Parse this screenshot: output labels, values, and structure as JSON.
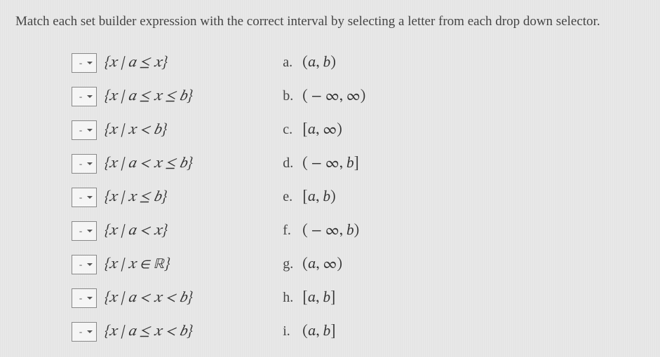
{
  "instructions": "Match each set builder expression with the correct interval by selecting a letter from each drop down selector.",
  "selector_placeholder": "-",
  "questions": [
    {
      "expr": "{𝑥 | 𝑎 ≤ 𝑥}"
    },
    {
      "expr": "{𝑥 | 𝑎 ≤ 𝑥 ≤ 𝑏}"
    },
    {
      "expr": "{𝑥 | 𝑥 < 𝑏}"
    },
    {
      "expr": "{𝑥 | 𝑎 < 𝑥 ≤ 𝑏}"
    },
    {
      "expr": "{𝑥 | 𝑥 ≤ 𝑏}"
    },
    {
      "expr": "{𝑥 | 𝑎 < 𝑥}"
    },
    {
      "expr": "{𝑥 | 𝑥 ∈ ℝ}"
    },
    {
      "expr": "{𝑥 | 𝑎 < 𝑥 < 𝑏}"
    },
    {
      "expr": "{𝑥 | 𝑎 ≤ 𝑥 < 𝑏}"
    }
  ],
  "answers": [
    {
      "label": "a.",
      "interval": "(𝑎, 𝑏)"
    },
    {
      "label": "b.",
      "interval": "( − ∞, ∞)"
    },
    {
      "label": "c.",
      "interval": "[𝑎, ∞)"
    },
    {
      "label": "d.",
      "interval": "( − ∞, 𝑏]"
    },
    {
      "label": "e.",
      "interval": "[𝑎, 𝑏)"
    },
    {
      "label": "f.",
      "interval": "( − ∞, 𝑏)"
    },
    {
      "label": "g.",
      "interval": "(𝑎, ∞)"
    },
    {
      "label": "h.",
      "interval": "[𝑎, 𝑏]"
    },
    {
      "label": "i.",
      "interval": "(𝑎, 𝑏]"
    }
  ]
}
